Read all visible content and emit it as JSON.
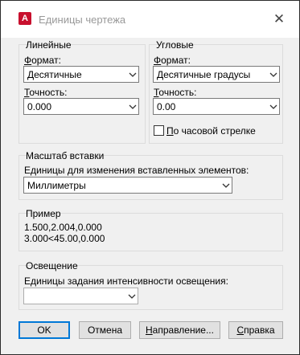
{
  "window": {
    "title": "Единицы чертежа",
    "app_icon_letter": "A"
  },
  "linear": {
    "group_title": "Линейные",
    "format_label": "Формат:",
    "format_value": "Десятичные",
    "precision_label": "Точность:",
    "precision_value": "0.000"
  },
  "angular": {
    "group_title": "Угловые",
    "format_label": "Формат:",
    "format_value": "Десятичные градусы",
    "precision_label": "Точность:",
    "precision_value": "0.00",
    "clockwise_label": "По часовой стрелке",
    "clockwise_checked": false
  },
  "insertion_scale": {
    "group_title": "Масштаб вставки",
    "units_label": "Единицы для изменения вставленных элементов:",
    "units_value": "Миллиметры"
  },
  "sample": {
    "group_title": "Пример",
    "line1": "1.500,2.004,0.000",
    "line2": "3.000<45.00,0.000"
  },
  "lighting": {
    "group_title": "Освещение",
    "units_label": "Единицы задания интенсивности освещения:",
    "units_value": ""
  },
  "buttons": {
    "ok": "OK",
    "cancel": "Отмена",
    "direction": "Направление...",
    "help": "Справка"
  }
}
